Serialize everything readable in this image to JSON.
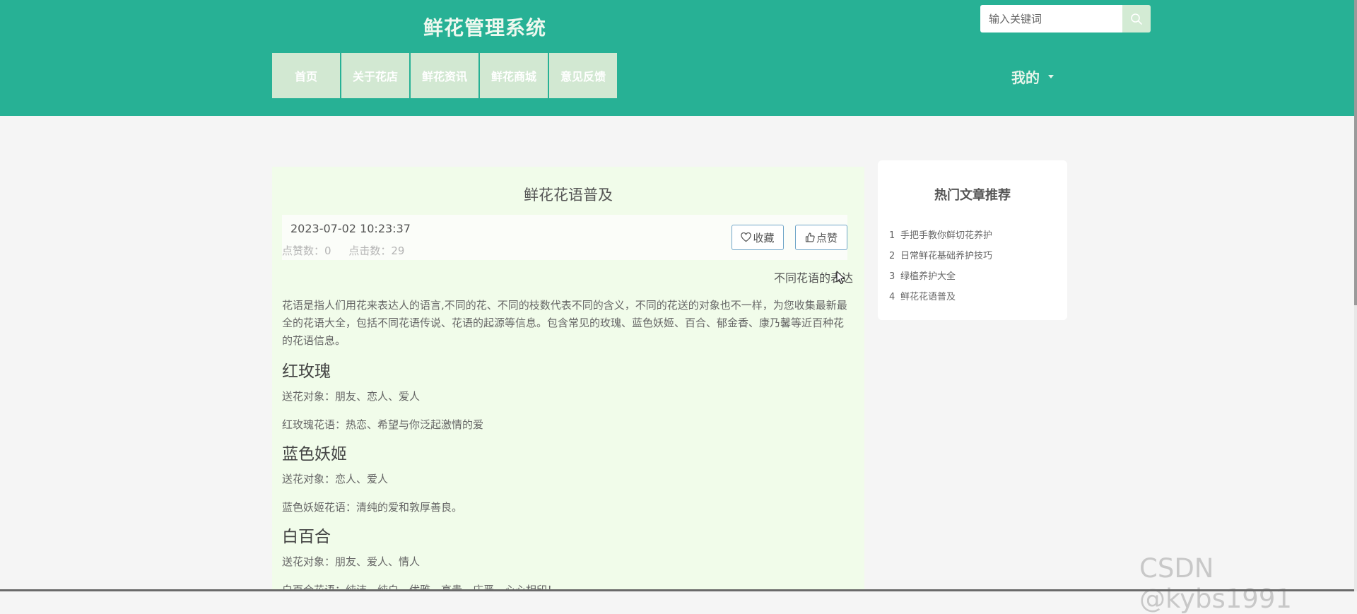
{
  "header": {
    "site_title": "鲜花管理系统",
    "search": {
      "placeholder": "输入关键词"
    },
    "nav": [
      "首页",
      "关于花店",
      "鲜花资讯",
      "鲜花商城",
      "意见反馈"
    ],
    "user_menu": "我的"
  },
  "article": {
    "title": "鲜花花语普及",
    "date": "2023-07-02 10:23:37",
    "likes_label": "点赞数：0",
    "clicks_label": "点击数：29",
    "favorite_label": "收藏",
    "like_label": "点赞",
    "subtitle": "不同花语的表达",
    "intro": "花语是指人们用花来表达人的语言,不同的花、不同的枝数代表不同的含义，不同的花送的对象也不一样，为您收集最新最全的花语大全，包括不同花语传说、花语的起源等信息。包含常见的玫瑰、蓝色妖姬、百合、郁金香、康乃馨等近百种花的花语信息。",
    "sections": [
      {
        "heading": "红玫瑰",
        "recipients": "送花对象：朋友、恋人、爱人",
        "meaning": "红玫瑰花语：热恋、希望与你泛起激情的爱"
      },
      {
        "heading": "蓝色妖姬",
        "recipients": "送花对象：恋人、爱人",
        "meaning": "蓝色妖姬花语：清纯的爱和敦厚善良。"
      },
      {
        "heading": "白百合",
        "recipients": "送花对象：朋友、爱人、情人",
        "meaning": "白百合花语：纯洁、纯白、优雅、高贵、庄严、心心相印！"
      }
    ]
  },
  "sidebar": {
    "title": "热门文章推荐",
    "items": [
      {
        "num": "1",
        "label": "手把手教你鲜切花养护"
      },
      {
        "num": "2",
        "label": "日常鲜花基础养护技巧"
      },
      {
        "num": "3",
        "label": "绿植养护大全"
      },
      {
        "num": "4",
        "label": "鲜花花语普及"
      }
    ]
  },
  "watermark": "CSDN @kybs1991",
  "colors": {
    "header_bg": "#27b195",
    "nav_bg": "#d2e8d2",
    "panel_bg": "#f1fcea",
    "button_border": "#6fa5c8"
  },
  "icons": [
    "search-icon",
    "heart-icon",
    "thumbs-up-icon",
    "caret-down-icon",
    "mouse-cursor-icon"
  ]
}
